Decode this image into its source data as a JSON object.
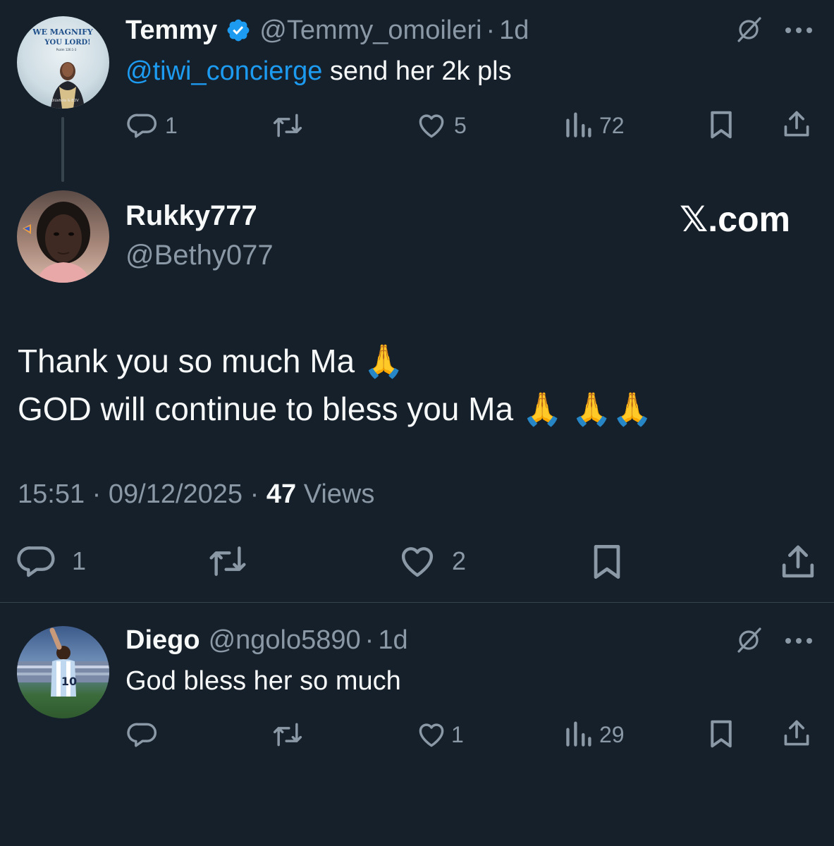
{
  "reply1": {
    "name": "Temmy",
    "verified": true,
    "handle": "@Temmy_omoileri",
    "separator": "·",
    "time": "1d",
    "mention": "@tiwi_concierge",
    "text": " send her 2k pls",
    "avatar_art": {
      "line1": "WE MAGNIFY",
      "line2": "YOU LORD!",
      "line3": "Psalm 126:1-3",
      "footer": "Olúshola & EOV"
    },
    "replies": "1",
    "likes": "5",
    "views": "72"
  },
  "main_tweet": {
    "name": "Rukky777",
    "handle": "@Bethy077",
    "brand": "𝕏.com",
    "line1": "Thank you so much Ma 🙏",
    "line2": "GOD will continue to bless you Ma 🙏 🙏🙏",
    "time": "15:51",
    "dot": "·",
    "date": "09/12/2025",
    "views_count": "47",
    "views_label": "Views",
    "replies": "1",
    "likes": "2"
  },
  "reply2": {
    "name": "Diego",
    "handle": "@ngolo5890",
    "separator": "·",
    "time": "1d",
    "text": "God bless her so much",
    "likes": "1",
    "views": "29"
  },
  "colors": {
    "background": "#15202b",
    "text": "#f7f9f9",
    "muted": "#8b98a5",
    "link": "#1d9bf0",
    "verified": "#1d9bf0",
    "divider": "#38444d"
  },
  "icons": [
    "verified-badge-icon",
    "grok-icon",
    "more-icon",
    "reply-icon",
    "repost-icon",
    "like-icon",
    "views-icon",
    "bookmark-icon",
    "share-icon"
  ]
}
